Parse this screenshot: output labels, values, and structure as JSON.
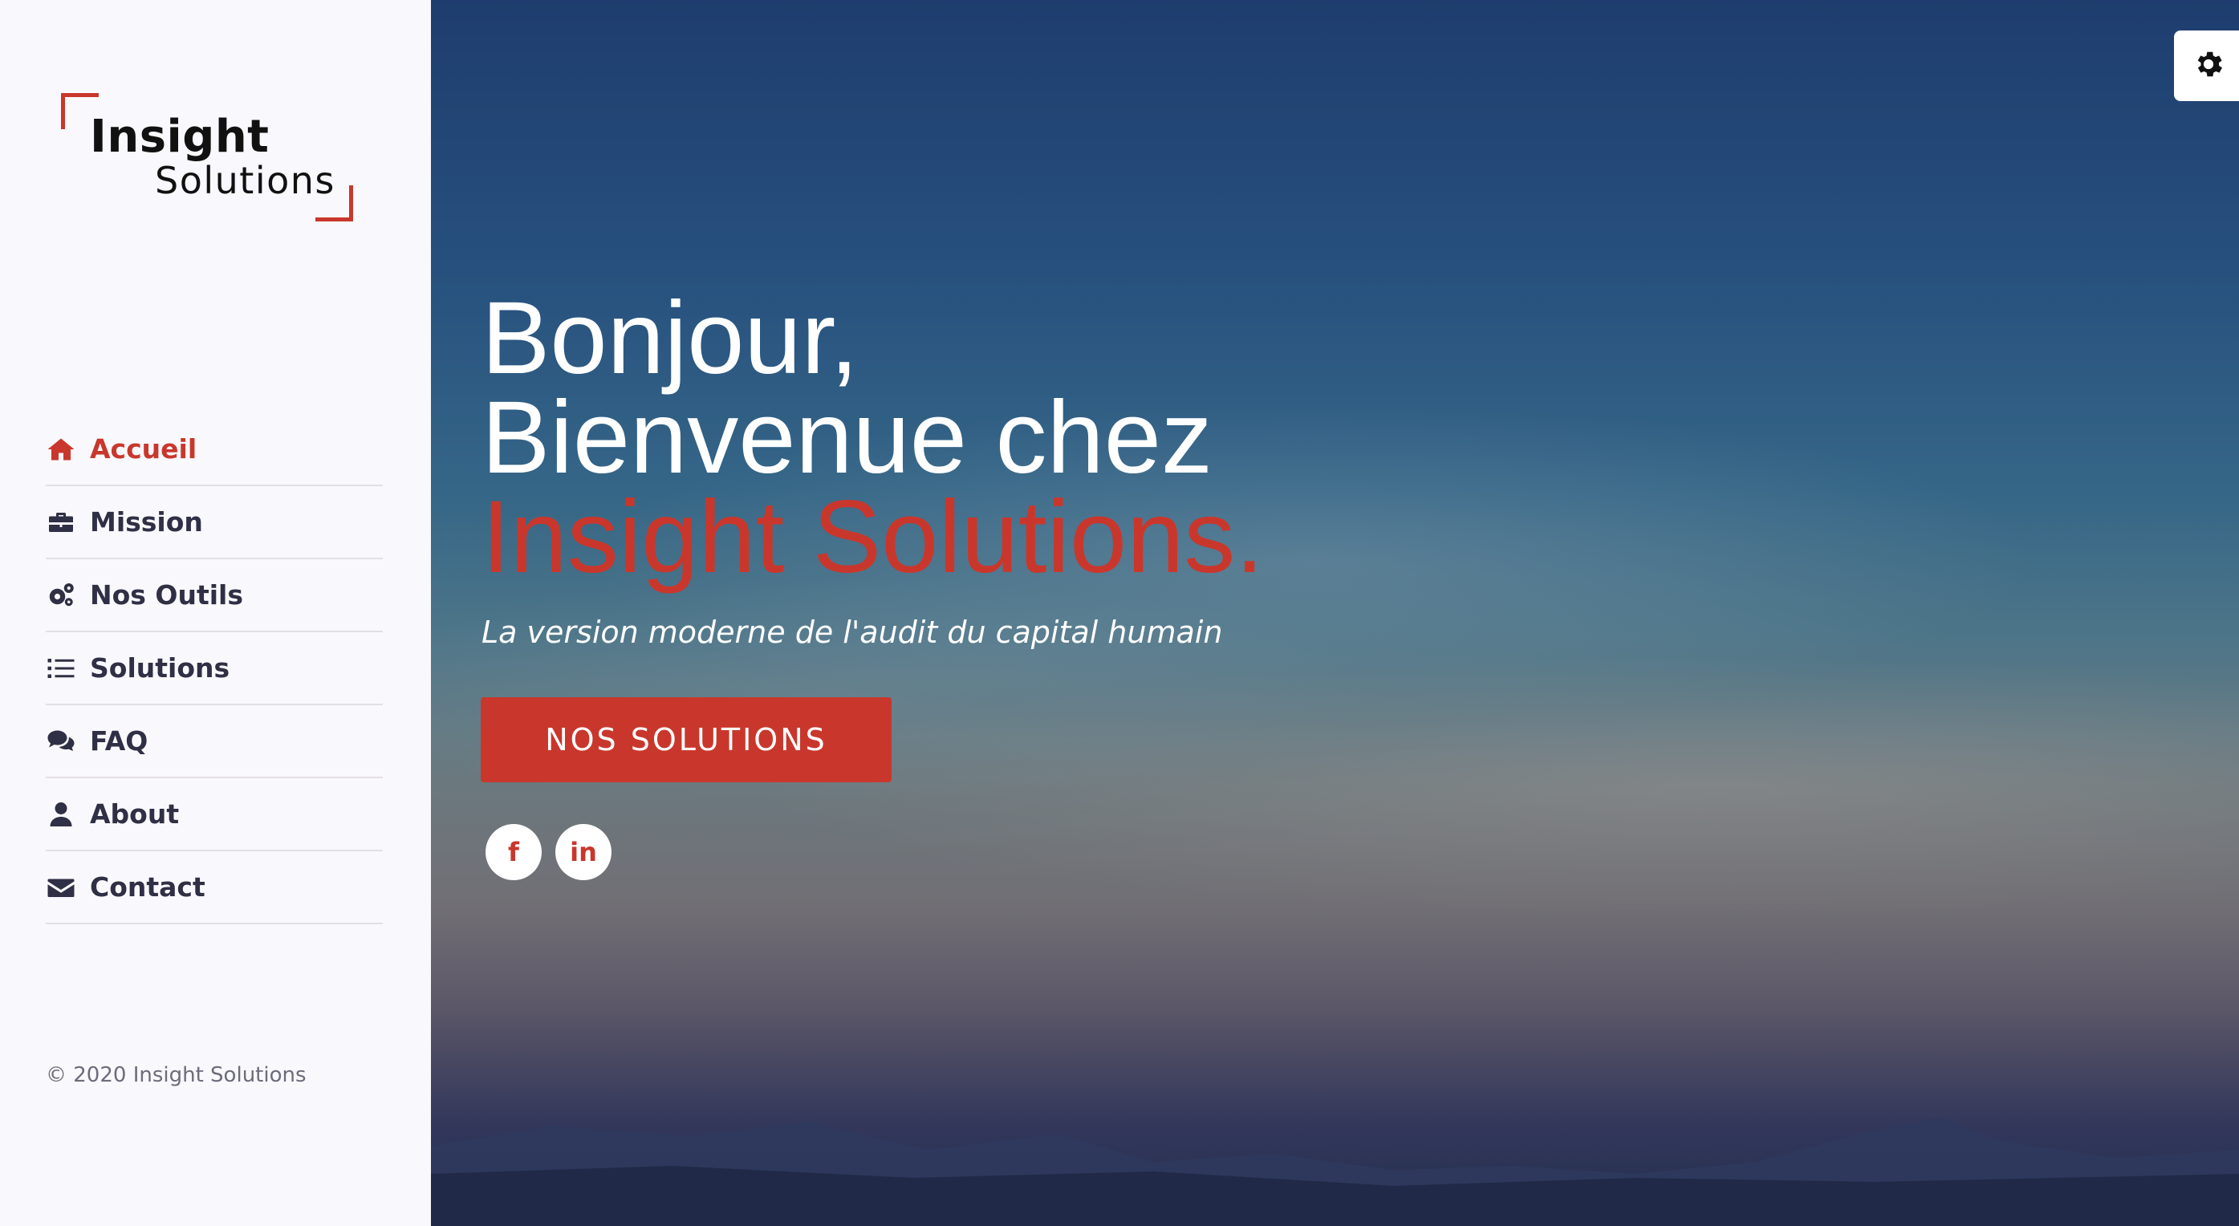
{
  "logo": {
    "line1": "Insight",
    "line2": "Solutions"
  },
  "nav": {
    "items": [
      {
        "label": "Accueil",
        "icon": "home-icon",
        "active": true
      },
      {
        "label": "Mission",
        "icon": "briefcase-icon"
      },
      {
        "label": "Nos Outils",
        "icon": "cogs-icon"
      },
      {
        "label": "Solutions",
        "icon": "list-icon"
      },
      {
        "label": "FAQ",
        "icon": "comments-icon"
      },
      {
        "label": "About",
        "icon": "user-icon"
      },
      {
        "label": "Contact",
        "icon": "envelope-icon"
      }
    ]
  },
  "footer": {
    "copyright": "© 2020 Insight Solutions"
  },
  "hero": {
    "line1": "Bonjour,",
    "line2": "Bienvenue chez",
    "line3": "Insight Solutions.",
    "tagline": "La version moderne de l'audit du capital humain",
    "cta_label": "NOS SOLUTIONS",
    "social": [
      {
        "label": "f",
        "icon": "facebook-icon"
      },
      {
        "label": "in",
        "icon": "linkedin-icon"
      }
    ]
  },
  "settings": {
    "icon": "gear-icon"
  },
  "colors": {
    "accent": "#c9372c",
    "sidebar_bg": "#f9f8fc",
    "nav_text": "#2f2f45"
  }
}
